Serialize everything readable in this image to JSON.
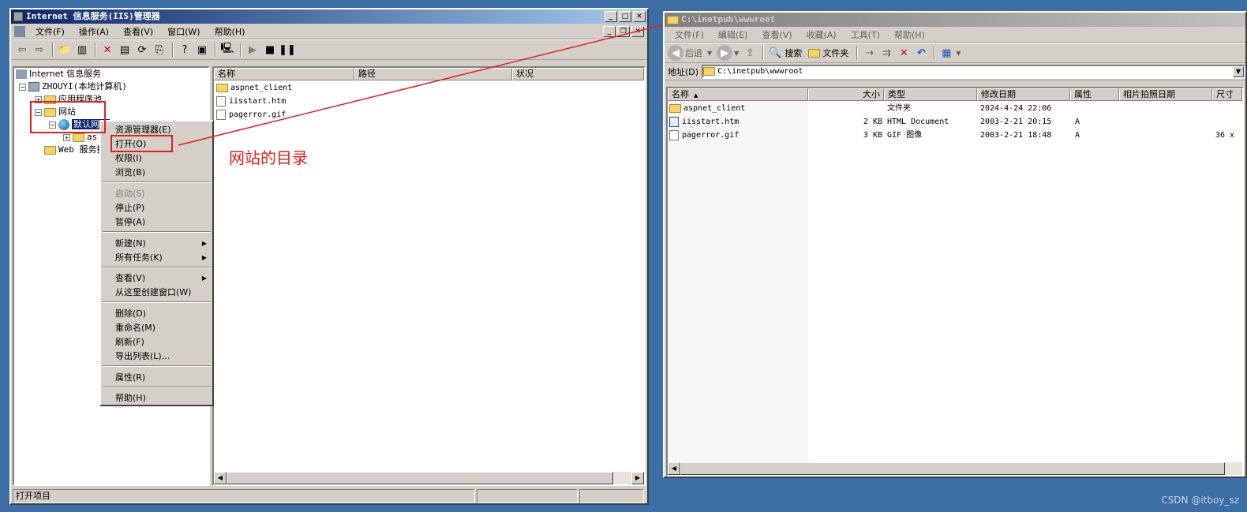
{
  "iis": {
    "title": "Internet 信息服务(IIS)管理器",
    "menu": [
      "文件(F)",
      "操作(A)",
      "查看(V)",
      "窗口(W)",
      "帮助(H)"
    ],
    "tree": {
      "root": "Internet 信息服务",
      "computer": "ZHOUYI(本地计算机)",
      "app_pools": "应用程序池",
      "websites": "网站",
      "default_site": "默认网站",
      "aspnet_child": "as",
      "web_ext": "Web 服务扩展"
    },
    "columns": [
      "名称",
      "路径",
      "状况"
    ],
    "files": [
      "aspnet_client",
      "iisstart.htm",
      "pagerror.gif"
    ],
    "status": "打开项目"
  },
  "context_menu": {
    "items": [
      {
        "label": "资源管理器(E)",
        "disabled": false
      },
      {
        "label": "打开(O)",
        "disabled": false
      },
      {
        "label": "权限(I)",
        "disabled": false
      },
      {
        "label": "浏览(B)",
        "disabled": false
      },
      {
        "label": "启动(S)",
        "disabled": true
      },
      {
        "label": "停止(P)",
        "disabled": false
      },
      {
        "label": "暂停(A)",
        "disabled": false
      },
      {
        "label": "新建(N)",
        "disabled": false,
        "submenu": true
      },
      {
        "label": "所有任务(K)",
        "disabled": false,
        "submenu": true
      },
      {
        "label": "查看(V)",
        "disabled": false,
        "submenu": true
      },
      {
        "label": "从这里创建窗口(W)",
        "disabled": false
      },
      {
        "label": "删除(D)",
        "disabled": false
      },
      {
        "label": "重命名(M)",
        "disabled": false
      },
      {
        "label": "刷新(F)",
        "disabled": false
      },
      {
        "label": "导出列表(L)...",
        "disabled": false
      },
      {
        "label": "属性(R)",
        "disabled": false
      },
      {
        "label": "帮助(H)",
        "disabled": false
      }
    ]
  },
  "annotation": {
    "text": "网站的目录",
    "color": "#e02020"
  },
  "explorer": {
    "title": "C:\\inetpub\\wwwroot",
    "menu": [
      "文件(F)",
      "编辑(E)",
      "查看(V)",
      "收藏(A)",
      "工具(T)",
      "帮助(H)"
    ],
    "toolbar": {
      "back": "后退",
      "search": "搜索",
      "folders": "文件夹"
    },
    "address_label": "地址(D)",
    "address_value": "C:\\inetpub\\wwwroot",
    "columns": [
      "名称",
      "大小",
      "类型",
      "修改日期",
      "属性",
      "相片拍照日期",
      "尺寸"
    ],
    "rows": [
      {
        "name": "aspnet_client",
        "size": "",
        "type": "文件夹",
        "modified": "2024-4-24 22:06",
        "attr": "",
        "extra": ""
      },
      {
        "name": "iisstart.htm",
        "size": "2 KB",
        "type": "HTML Document",
        "modified": "2003-2-21 20:15",
        "attr": "A",
        "extra": ""
      },
      {
        "name": "pagerror.gif",
        "size": "3 KB",
        "type": "GIF 图像",
        "modified": "2003-2-21 18:48",
        "attr": "A",
        "extra": "36 x"
      }
    ]
  },
  "watermark": "CSDN @itboy_sz"
}
